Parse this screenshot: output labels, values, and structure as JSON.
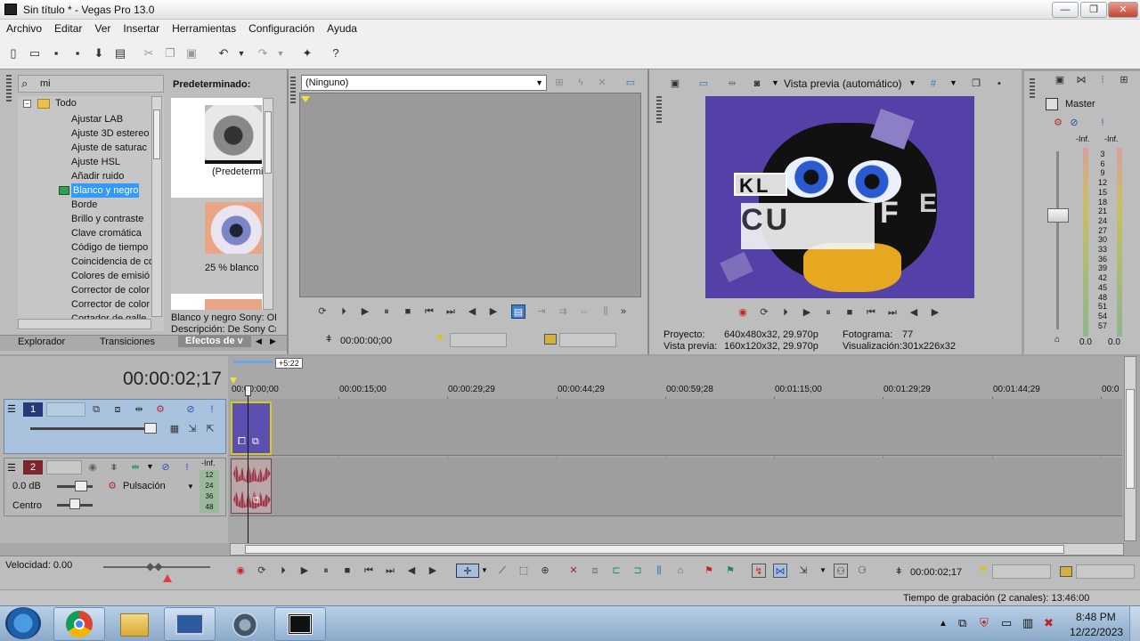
{
  "window": {
    "title": "Sin título * - Vegas Pro 13.0",
    "min": "—",
    "max": "❐",
    "close": "✕"
  },
  "menu": [
    "Archivo",
    "Editar",
    "Ver",
    "Insertar",
    "Herramientas",
    "Configuración",
    "Ayuda"
  ],
  "explorer": {
    "search_value": "mi",
    "root": "Todo",
    "items": [
      "Ajustar LAB",
      "Ajuste 3D estereo",
      "Ajuste de saturac",
      "Ajuste HSL",
      "Añadir ruido",
      "Blanco y negro",
      "Borde",
      "Brillo y contraste",
      "Clave cromática",
      "Código de tiempo",
      "Coincidencia de co",
      "Colores de emisió",
      "Corrector de color",
      "Corrector de color",
      "Cortador de galle"
    ],
    "selected_index": 5,
    "presets_header": "Predeterminado:",
    "preset_labels": [
      "(Predetermi",
      "25 % blanco"
    ],
    "desc_line1": "Blanco y negro Sony: OF",
    "desc_line2": "Descripción: De Sony Cre",
    "tabs": [
      "Explorador",
      "Transiciones",
      "Efectos de v"
    ]
  },
  "trimmer": {
    "select_value": "(Ninguno)",
    "timecode": "00:00:00;00"
  },
  "preview": {
    "mode": "Vista previa (automático)",
    "info": {
      "proyecto_label": "Proyecto:",
      "proyecto_value": "640x480x32, 29.970p",
      "vista_label": "Vista previa:",
      "vista_value": "160x120x32, 29.970p",
      "fotograma_label": "Fotograma:",
      "fotograma_value": "77",
      "visual_label": "Visualización:",
      "visual_value": "301x226x32"
    },
    "overlay_text": [
      "K",
      "L",
      "C",
      "U",
      "F",
      "E"
    ]
  },
  "mixer": {
    "master_label": "Master",
    "inf_left": "-Inf.",
    "inf_right": "-Inf.",
    "scale": [
      "3",
      "6",
      "9",
      "12",
      "15",
      "18",
      "21",
      "24",
      "27",
      "30",
      "33",
      "36",
      "39",
      "42",
      "45",
      "48",
      "51",
      "54",
      "57"
    ],
    "bottom_left": "0.0",
    "bottom_right": "0.0"
  },
  "timeline": {
    "position": "00:00:02;17",
    "marker_badge": "+5:22",
    "ticks": [
      "00:00:00;00",
      "00:00:15;00",
      "00:00:29;29",
      "00:00:44;29",
      "00:00:59;28",
      "00:01:15;00",
      "00:01:29;29",
      "00:01:44;29",
      "00:0"
    ],
    "track1_num": "1",
    "track2_num": "2",
    "track2_volume": "0.0 dB",
    "track2_pan": "Centro",
    "track2_fx": "Pulsación",
    "track2_meter_inf": "-Inf.",
    "track2_meter_scale": [
      "12",
      "24",
      "36",
      "48"
    ],
    "speed": "Velocidad: 0.00",
    "transport_timecode": "00:00:02;17"
  },
  "status": {
    "rec_time": "Tiempo de grabación (2 canales): 13:46:00"
  },
  "taskbar": {
    "time": "8:48 PM",
    "date": "12/22/2023"
  },
  "colors": {
    "selection": "#3399ff",
    "video_clip": "#5b4fb0",
    "audio_clip": "#9a3a4a",
    "track_header_video": "#a9c3df"
  }
}
